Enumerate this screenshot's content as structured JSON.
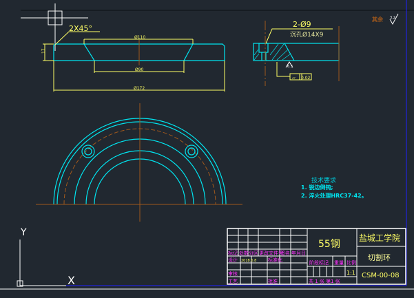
{
  "front_view": {
    "chamfer": "2X45°",
    "dim_top": "Ø110",
    "dim_bottom": "Ø90",
    "dim_overall": "Ø172",
    "dim_height": "17"
  },
  "section_view": {
    "holes": "2-Ø9",
    "counterbore": "沉孔Ø14X9",
    "roughness": "6.3",
    "flatness_symbol": "▱",
    "flatness_value": "0.02"
  },
  "roughness_note": {
    "label": "其余",
    "value": "3.2"
  },
  "tech_requirements": {
    "title": "技术要求",
    "items": [
      "1. 锐边倒钝;",
      "2. 淬火处理HRC37-42。"
    ]
  },
  "ucs": {
    "y_label": "Y",
    "x_label": "X"
  },
  "title_block": {
    "material": "55钢",
    "school": "盐城工学院",
    "part_name": "切割环",
    "drawing_no": "CSM-00-08",
    "headers": [
      "标记",
      "处数",
      "分区",
      "更改文件号",
      "签名",
      "年月日"
    ],
    "design": "设计",
    "designer": "2018.6.8",
    "standardization": "标准化",
    "review": "审核",
    "process": "工艺",
    "approve": "批准",
    "stage_mark": "阶段标记",
    "weight": "重量",
    "scale_label": "比例",
    "scale": "1:1",
    "sheets": "共 1 张  第1 张"
  }
}
